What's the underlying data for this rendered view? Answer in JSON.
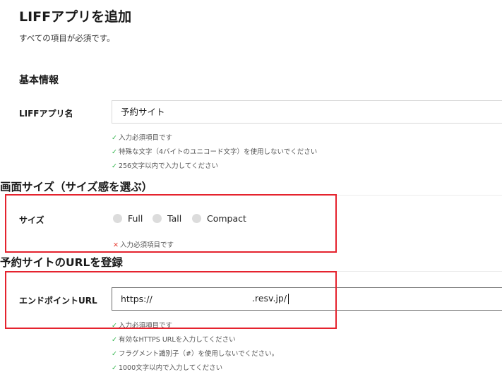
{
  "page": {
    "title": "LIFFアプリを追加",
    "subtitle": "すべての項目が必須です。"
  },
  "basic_info": {
    "section_title": "基本情報",
    "app_name": {
      "label": "LIFFアプリ名",
      "value": "予約サイト",
      "hints": [
        "入力必須項目です",
        "特殊な文字（4バイトのユニコード文字）を使用しないでください",
        "256文字以内で入力してください"
      ]
    }
  },
  "annotations": {
    "size": "画面サイズ（サイズ感を選ぶ）",
    "url": "予約サイトのURLを登録"
  },
  "size": {
    "label": "サイズ",
    "options": [
      "Full",
      "Tall",
      "Compact"
    ],
    "error": "入力必須項目です"
  },
  "endpoint": {
    "label": "エンドポイントURL",
    "value_prefix": "https://",
    "value_suffix": ".resv.jp/",
    "hints": [
      "入力必須項目です",
      "有効なHTTPS URLを入力してください",
      "フラグメント識別子（#）を使用しないでください。",
      "1000文字以内で入力してください"
    ]
  },
  "icons": {
    "check": "check-icon",
    "cross": "cross-icon"
  },
  "colors": {
    "ok": "#2fb44a",
    "error": "#e8443a",
    "highlight": "#e5232e"
  }
}
